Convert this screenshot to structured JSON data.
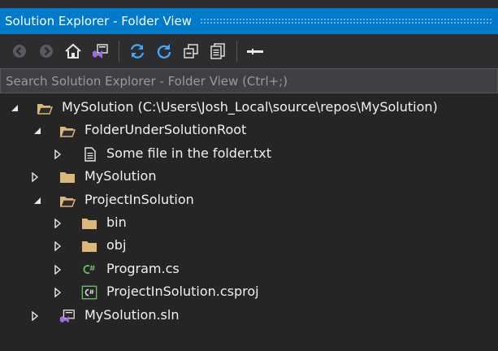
{
  "window": {
    "title": "Solution Explorer - Folder View"
  },
  "toolbar": {
    "buttons": [
      {
        "name": "back-icon"
      },
      {
        "name": "forward-icon"
      },
      {
        "name": "home-icon"
      },
      {
        "name": "switch-views-icon"
      },
      {
        "name": "sync-icon"
      },
      {
        "name": "refresh-icon"
      },
      {
        "name": "collapse-all-icon"
      },
      {
        "name": "show-all-files-icon"
      },
      {
        "name": "pin-icon"
      }
    ]
  },
  "search": {
    "placeholder": "Search Solution Explorer - Folder View (Ctrl+;)",
    "value": ""
  },
  "tree": {
    "items": [
      {
        "label": "MySolution (C:\\Users\\Josh_Local\\source\\repos\\MySolution)",
        "icon": "folder-open-icon",
        "expanded": true
      },
      {
        "label": "FolderUnderSolutionRoot",
        "icon": "folder-open-icon",
        "expanded": true
      },
      {
        "label": "Some file in the folder.txt",
        "icon": "text-file-icon",
        "expanded": false
      },
      {
        "label": "MySolution",
        "icon": "folder-icon",
        "expanded": false
      },
      {
        "label": "ProjectInSolution",
        "icon": "folder-open-icon",
        "expanded": true
      },
      {
        "label": "bin",
        "icon": "folder-icon",
        "expanded": false
      },
      {
        "label": "obj",
        "icon": "folder-icon",
        "expanded": false
      },
      {
        "label": "Program.cs",
        "icon": "csharp-file-icon",
        "expanded": false
      },
      {
        "label": "ProjectInSolution.csproj",
        "icon": "csproj-file-icon",
        "expanded": false
      },
      {
        "label": "MySolution.sln",
        "icon": "solution-file-icon",
        "expanded": false
      }
    ]
  },
  "colors": {
    "accent": "#007acc",
    "background": "#252526",
    "folder": "#dcb67a",
    "csharp": "#6abf69",
    "vs_purple": "#9b6ee0"
  }
}
